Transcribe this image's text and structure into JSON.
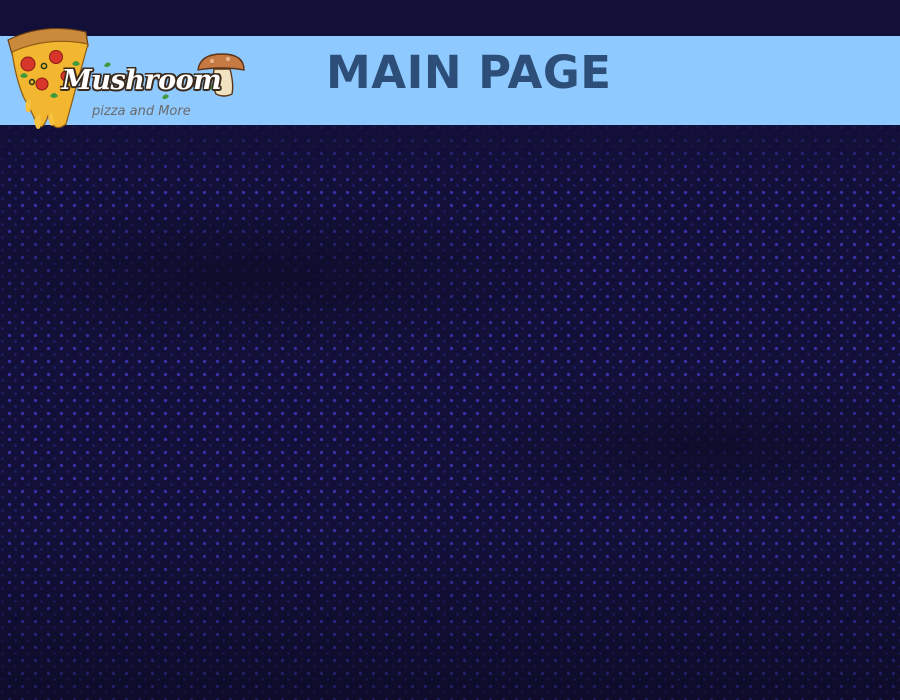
{
  "page": {
    "title": "MAIN PAGE"
  },
  "logo": {
    "name": "Mushroom",
    "tagline": "pizza and More",
    "icons": [
      "pizza-slice-icon",
      "mushroom-icon"
    ]
  },
  "colors": {
    "header_band": "#8ec9ff",
    "title_text": "#2c4e78",
    "background": "#121038",
    "dots": "#3a35b0"
  }
}
